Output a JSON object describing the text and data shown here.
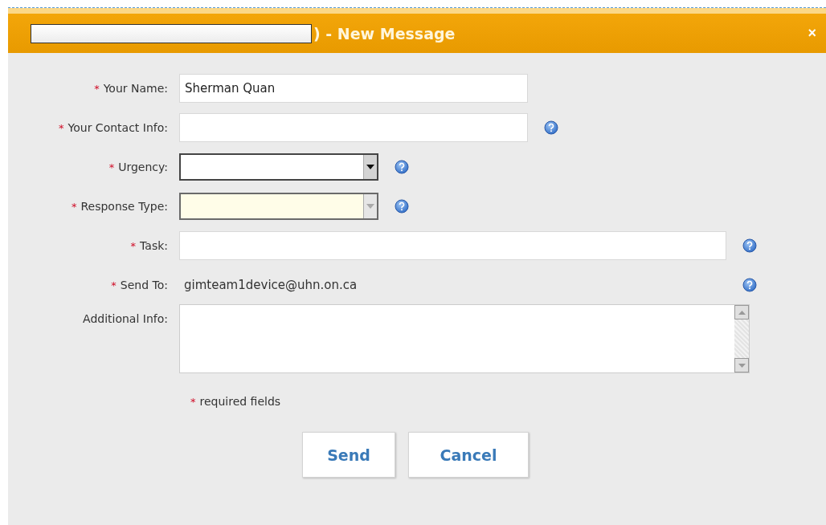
{
  "dialog": {
    "title": ") - New Message",
    "title_redacted": true,
    "close": "×"
  },
  "fields": [
    {
      "label": "Your Name:",
      "required": true,
      "kind": "text",
      "value": "Sherman Quan",
      "help": false
    },
    {
      "label": "Your Contact Info:",
      "required": true,
      "kind": "text",
      "help": true
    },
    {
      "label": "Urgency:",
      "required": true,
      "kind": "select",
      "disabled": false,
      "help": true
    },
    {
      "label": "Response Type:",
      "required": true,
      "kind": "select",
      "disabled": true,
      "help": true
    },
    {
      "label": "Task:",
      "required": true,
      "kind": "wide",
      "help": true
    },
    {
      "label": "Send To:",
      "required": true,
      "kind": "static",
      "value": "gimteam1device@uhn.on.ca",
      "help": true
    },
    {
      "label": "Additional Info:",
      "required": false,
      "kind": "textarea",
      "help": false
    }
  ],
  "required_note": {
    "mark": "*",
    "text": "required fields"
  },
  "buttons": [
    "Send",
    "Cancel"
  ]
}
